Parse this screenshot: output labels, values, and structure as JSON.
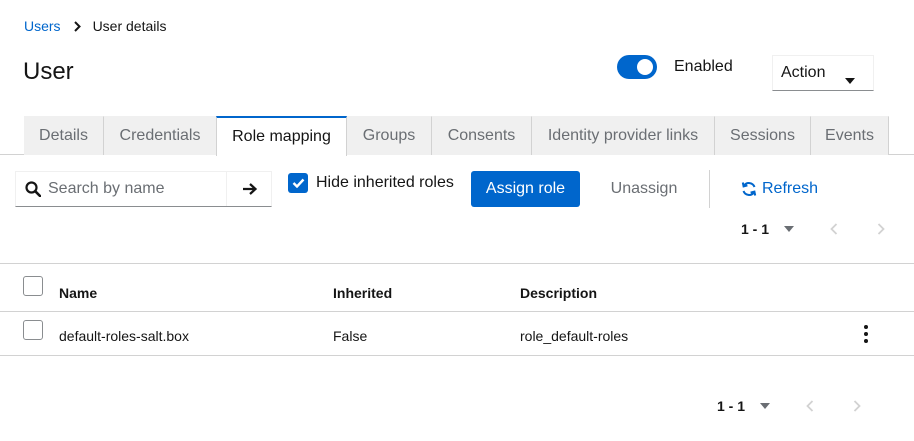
{
  "breadcrumb": {
    "parent": "Users",
    "current": "User details"
  },
  "page": {
    "title": "User"
  },
  "header": {
    "enabled_label": "Enabled",
    "enabled": true,
    "action_label": "Action"
  },
  "tabs": [
    {
      "label": "Details"
    },
    {
      "label": "Credentials"
    },
    {
      "label": "Role mapping",
      "active": true
    },
    {
      "label": "Groups"
    },
    {
      "label": "Consents"
    },
    {
      "label": "Identity provider links"
    },
    {
      "label": "Sessions"
    },
    {
      "label": "Events"
    }
  ],
  "toolbar": {
    "search_placeholder": "Search by name",
    "hide_inherited_label": "Hide inherited roles",
    "hide_inherited_checked": true,
    "assign_label": "Assign role",
    "unassign_label": "Unassign",
    "refresh_label": "Refresh"
  },
  "pagination_top": {
    "range": "1 - 1"
  },
  "pagination_bottom": {
    "range": "1 - 1"
  },
  "table": {
    "columns": [
      "Name",
      "Inherited",
      "Description"
    ],
    "rows": [
      {
        "name": "default-roles-salt.box",
        "inherited": "False",
        "description": "role_default-roles"
      }
    ]
  },
  "colors": {
    "accent": "#0066cc",
    "border": "#d2d2d2",
    "tab_bg": "#f0f0f0",
    "muted_text": "#6a6e73"
  },
  "icons": [
    "chevron-right-icon",
    "caret-down-icon",
    "search-icon",
    "arrow-right-icon",
    "check-icon",
    "sync-icon",
    "angle-left-icon",
    "angle-right-icon",
    "kebab-icon"
  ]
}
